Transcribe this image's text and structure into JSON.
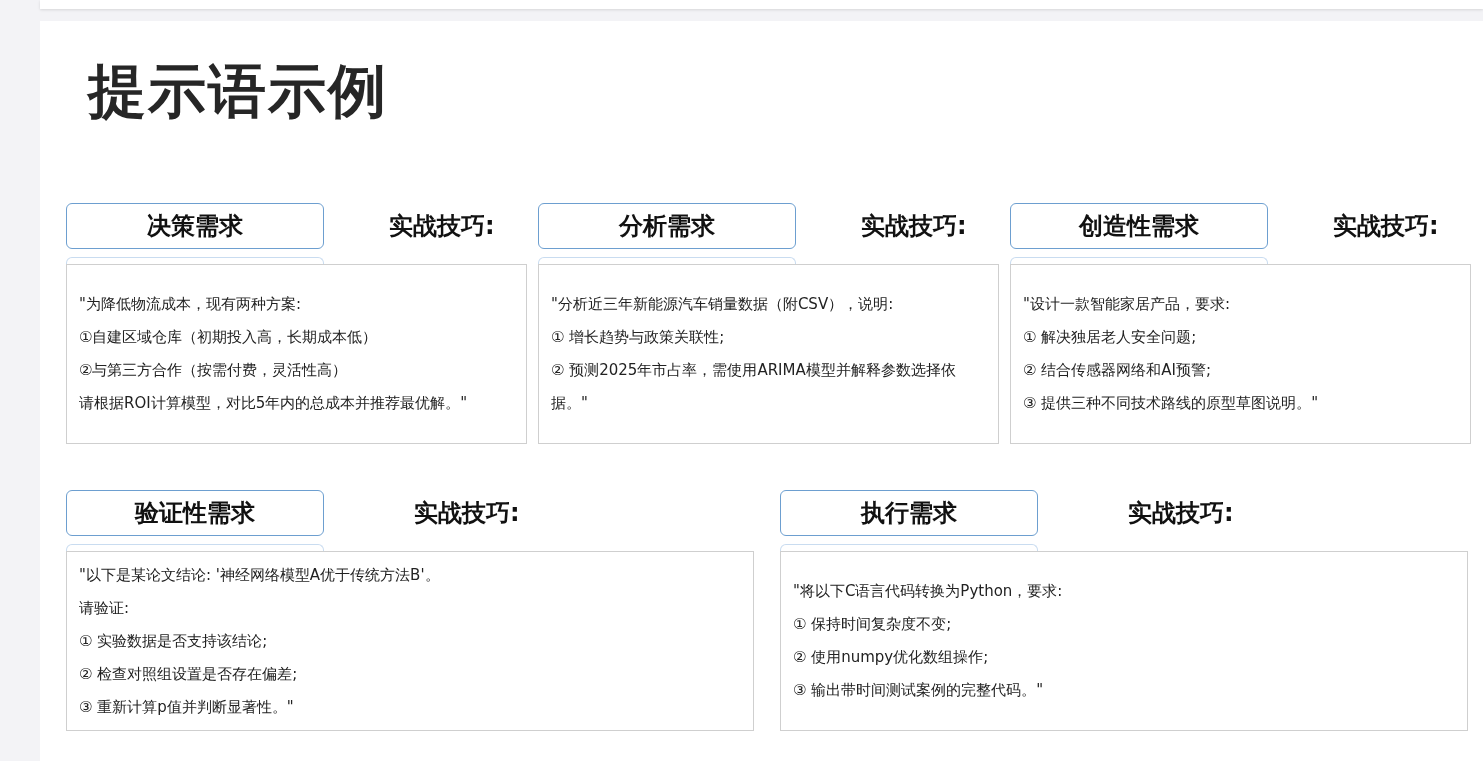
{
  "title": "提示语示例",
  "rows": [
    {
      "cards": [
        {
          "label": "决策需求",
          "tip_label": "实战技巧:",
          "lines": [
            "\"为降低物流成本，现有两种方案:",
            "①自建区域仓库（初期投入高，长期成本低）",
            "②与第三方合作（按需付费，灵活性高）",
            "请根据ROI计算模型，对比5年内的总成本并推荐最优解。\""
          ]
        },
        {
          "label": "分析需求",
          "tip_label": "实战技巧:",
          "lines": [
            "\"分析近三年新能源汽车销量数据（附CSV），说明:",
            "① 增长趋势与政策关联性;",
            "② 预测2025年市占率，需使用ARIMA模型并解释参数选择依据。\""
          ]
        },
        {
          "label": "创造性需求",
          "tip_label": "实战技巧:",
          "lines": [
            "\"设计一款智能家居产品，要求:",
            "① 解决独居老人安全问题;",
            "② 结合传感器网络和AI预警;",
            "③ 提供三种不同技术路线的原型草图说明。\""
          ]
        }
      ]
    },
    {
      "cards": [
        {
          "label": "验证性需求",
          "tip_label": "实战技巧:",
          "lines": [
            "\"以下是某论文结论: '神经网络模型A优于传统方法B'。",
            "请验证:",
            "① 实验数据是否支持该结论;",
            "② 检查对照组设置是否存在偏差;",
            "③ 重新计算p值并判断显著性。\""
          ]
        },
        {
          "label": "执行需求",
          "tip_label": "实战技巧:",
          "lines": [
            "\"将以下C语言代码转换为Python，要求:",
            "① 保持时间复杂度不变;",
            "② 使用numpy优化数组操作;",
            "③ 输出带时间测试案例的完整代码。\""
          ]
        }
      ]
    }
  ]
}
